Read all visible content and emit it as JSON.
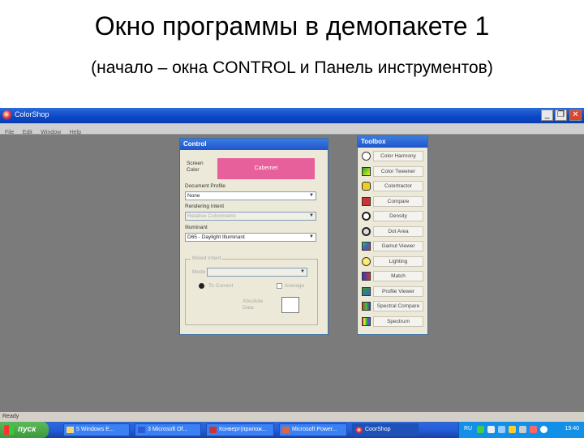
{
  "slide": {
    "title": "Окно программы в демопакете 1",
    "subtitle": "(начало – окна CONTROL и Панель инструментов)"
  },
  "app": {
    "title": "ColorShop",
    "menu": [
      "File",
      "Edit",
      "Window",
      "Help"
    ],
    "status": "Ready"
  },
  "control": {
    "title": "Control",
    "screen_label": "Screen Color",
    "screen_value": "Cabernet",
    "screen_color": "#e8609b",
    "document_profile_label": "Document Profile",
    "document_profile_value": "None",
    "rendering_intent_label": "Rendering Intent",
    "rendering_intent_value": "Relative Colorimetric",
    "illuminant_label": "Illuminant",
    "illuminant_value": "D65 - Daylight Illuminant",
    "group_label": "Mixed Intent",
    "mode_label": "Mode",
    "radio_label": "To Current",
    "check_label": "Average",
    "absolute_label": "Absolute Data"
  },
  "toolbox": {
    "title": "Toolbox",
    "items": [
      {
        "label": "Color Harmony",
        "icon": "color-harmony-icon"
      },
      {
        "label": "Color Tweener",
        "icon": "color-tweener-icon"
      },
      {
        "label": "Colortractor",
        "icon": "colortractor-icon"
      },
      {
        "label": "Compare",
        "icon": "compare-icon"
      },
      {
        "label": "Density",
        "icon": "density-icon"
      },
      {
        "label": "Dot Area",
        "icon": "dot-area-icon"
      },
      {
        "label": "Gamut Viewer",
        "icon": "gamut-viewer-icon"
      },
      {
        "label": "Lighting",
        "icon": "lighting-icon"
      },
      {
        "label": "Match",
        "icon": "match-icon"
      },
      {
        "label": "Profile Viewer",
        "icon": "profile-viewer-icon"
      },
      {
        "label": "Spectral Compare",
        "icon": "spectral-compare-icon"
      },
      {
        "label": "Spectrum",
        "icon": "spectrum-icon"
      }
    ]
  },
  "taskbar": {
    "start_label": "пуск",
    "tasks": [
      "5 Windows E...",
      "3 Microsoft Of...",
      "Конверт(прилож...",
      "Microsoft Power...",
      "CoorShop"
    ],
    "language": "RU",
    "clock": "19:40"
  }
}
